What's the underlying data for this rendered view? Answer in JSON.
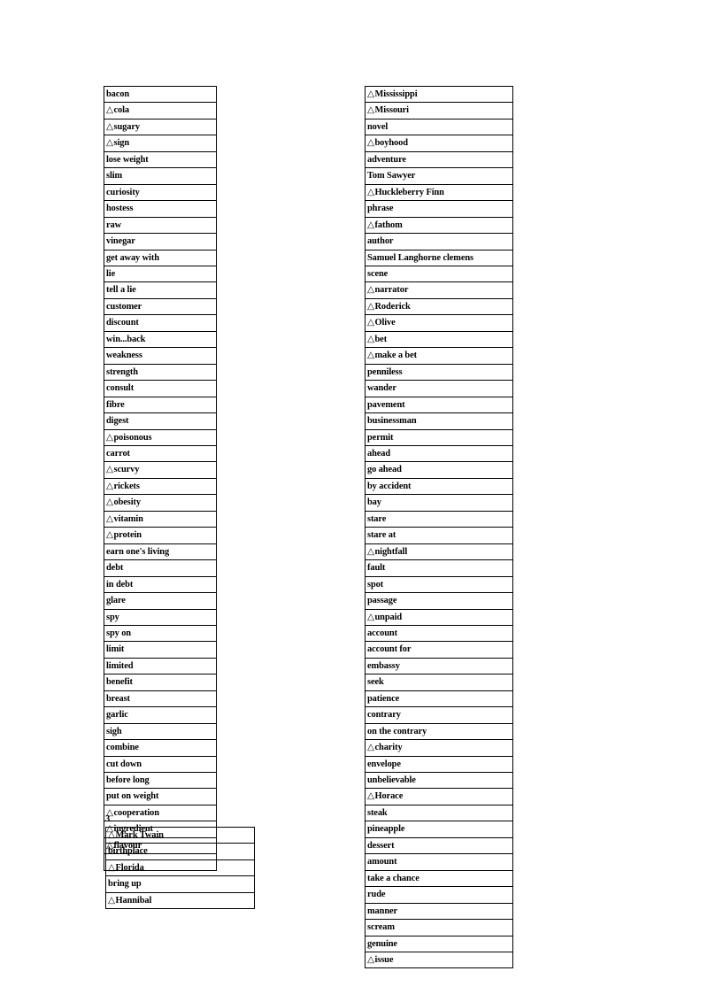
{
  "document": {
    "page_background": "#ffffff",
    "text_color": "#000000",
    "marker_glyph": "△",
    "marker_name": "triangle-new-word-marker"
  },
  "section_label": "3",
  "tables": {
    "left_1": {
      "name": "vocabulary-table-left-part1",
      "rows": [
        {
          "marker": false,
          "text": "bacon"
        },
        {
          "marker": true,
          "text": "cola"
        },
        {
          "marker": true,
          "text": "sugary"
        },
        {
          "marker": true,
          "text": "sign"
        },
        {
          "marker": false,
          "text": "lose weight"
        },
        {
          "marker": false,
          "text": "slim"
        },
        {
          "marker": false,
          "text": "curiosity"
        },
        {
          "marker": false,
          "text": "hostess"
        },
        {
          "marker": false,
          "text": "raw"
        },
        {
          "marker": false,
          "text": "vinegar"
        },
        {
          "marker": false,
          "text": "get away with"
        },
        {
          "marker": false,
          "text": "lie"
        },
        {
          "marker": false,
          "text": "tell a lie"
        },
        {
          "marker": false,
          "text": "customer"
        },
        {
          "marker": false,
          "text": "discount"
        },
        {
          "marker": false,
          "text": "win...back"
        },
        {
          "marker": false,
          "text": "weakness"
        },
        {
          "marker": false,
          "text": "strength"
        },
        {
          "marker": false,
          "text": "consult"
        },
        {
          "marker": false,
          "text": "fibre"
        },
        {
          "marker": false,
          "text": "digest"
        },
        {
          "marker": true,
          "text": "poisonous"
        },
        {
          "marker": false,
          "text": "carrot"
        },
        {
          "marker": true,
          "text": "scurvy"
        },
        {
          "marker": true,
          "text": "rickets"
        },
        {
          "marker": true,
          "text": "obesity"
        },
        {
          "marker": true,
          "text": "vitamin"
        },
        {
          "marker": true,
          "text": "protein"
        },
        {
          "marker": false,
          "text": "earn one's living"
        },
        {
          "marker": false,
          "text": "debt"
        },
        {
          "marker": false,
          "text": "in debt"
        },
        {
          "marker": false,
          "text": "glare"
        },
        {
          "marker": false,
          "text": "spy"
        },
        {
          "marker": false,
          "text": "spy on"
        },
        {
          "marker": false,
          "text": "limit"
        },
        {
          "marker": false,
          "text": "limited"
        },
        {
          "marker": false,
          "text": "benefit"
        },
        {
          "marker": false,
          "text": "breast"
        },
        {
          "marker": false,
          "text": "garlic"
        },
        {
          "marker": false,
          "text": "sigh"
        },
        {
          "marker": false,
          "text": "combine"
        },
        {
          "marker": false,
          "text": "cut down"
        },
        {
          "marker": false,
          "text": "before long"
        },
        {
          "marker": false,
          "text": "put on weight"
        },
        {
          "marker": true,
          "text": "cooperation"
        },
        {
          "marker": true,
          "text": "ingredient"
        },
        {
          "marker": true,
          "text": "flavour"
        },
        {
          "marker": false,
          "text": ""
        }
      ]
    },
    "left_2": {
      "name": "vocabulary-table-left-part2",
      "rows": [
        {
          "marker": true,
          "text": "Mark Twain"
        },
        {
          "marker": false,
          "text": "birthplace"
        },
        {
          "marker": true,
          "text": "Florida"
        },
        {
          "marker": false,
          "text": "bring up"
        },
        {
          "marker": true,
          "text": "Hannibal"
        }
      ]
    },
    "right_1": {
      "name": "vocabulary-table-right",
      "rows": [
        {
          "marker": true,
          "text": "Mississippi"
        },
        {
          "marker": true,
          "text": "Missouri"
        },
        {
          "marker": false,
          "text": "novel"
        },
        {
          "marker": true,
          "text": "boyhood"
        },
        {
          "marker": false,
          "text": "adventure"
        },
        {
          "marker": false,
          "text": "Tom Sawyer"
        },
        {
          "marker": true,
          "text": "Huckleberry Finn"
        },
        {
          "marker": false,
          "text": "phrase"
        },
        {
          "marker": true,
          "text": "fathom"
        },
        {
          "marker": false,
          "text": "author"
        },
        {
          "marker": false,
          "text": "Samuel Langhorne clemens"
        },
        {
          "marker": false,
          "text": "scene"
        },
        {
          "marker": true,
          "text": "narrator"
        },
        {
          "marker": true,
          "text": "Roderick"
        },
        {
          "marker": true,
          "text": "Olive"
        },
        {
          "marker": true,
          "text": "bet"
        },
        {
          "marker": true,
          "text": "make a bet"
        },
        {
          "marker": false,
          "text": "penniless"
        },
        {
          "marker": false,
          "text": "wander"
        },
        {
          "marker": false,
          "text": "pavement"
        },
        {
          "marker": false,
          "text": "businessman"
        },
        {
          "marker": false,
          "text": "permit"
        },
        {
          "marker": false,
          "text": "ahead"
        },
        {
          "marker": false,
          "text": "go ahead"
        },
        {
          "marker": false,
          "text": "by accident"
        },
        {
          "marker": false,
          "text": "bay"
        },
        {
          "marker": false,
          "text": "stare"
        },
        {
          "marker": false,
          "text": "stare at"
        },
        {
          "marker": true,
          "text": "nightfall"
        },
        {
          "marker": false,
          "text": "fault"
        },
        {
          "marker": false,
          "text": "spot"
        },
        {
          "marker": false,
          "text": "passage"
        },
        {
          "marker": true,
          "text": "unpaid"
        },
        {
          "marker": false,
          "text": "account"
        },
        {
          "marker": false,
          "text": "account for"
        },
        {
          "marker": false,
          "text": "embassy"
        },
        {
          "marker": false,
          "text": "seek"
        },
        {
          "marker": false,
          "text": "patience"
        },
        {
          "marker": false,
          "text": "contrary"
        },
        {
          "marker": false,
          "text": "on the contrary"
        },
        {
          "marker": true,
          "text": "charity"
        },
        {
          "marker": false,
          "text": "envelope"
        },
        {
          "marker": false,
          "text": "unbelievable"
        },
        {
          "marker": true,
          "text": "Horace"
        },
        {
          "marker": false,
          "text": "steak"
        },
        {
          "marker": false,
          "text": "pineapple"
        },
        {
          "marker": false,
          "text": "dessert"
        },
        {
          "marker": false,
          "text": "amount"
        },
        {
          "marker": false,
          "text": "take a chance"
        },
        {
          "marker": false,
          "text": "rude"
        },
        {
          "marker": false,
          "text": "manner"
        },
        {
          "marker": false,
          "text": "scream"
        },
        {
          "marker": false,
          "text": "genuine"
        },
        {
          "marker": true,
          "text": "issue"
        }
      ]
    }
  }
}
